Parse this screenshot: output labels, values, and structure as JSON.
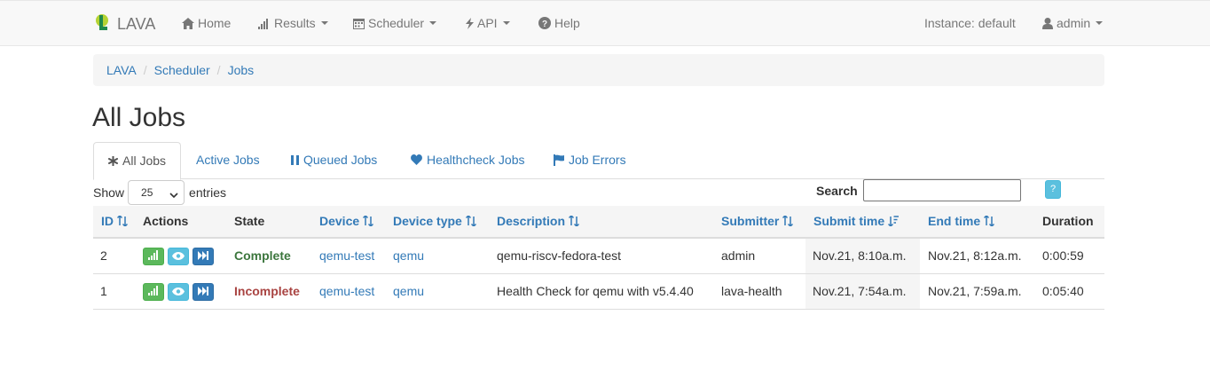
{
  "navbar": {
    "brand": "LAVA",
    "home": "Home",
    "results": "Results",
    "scheduler": "Scheduler",
    "api": "API",
    "help": "Help",
    "instance": "Instance: default",
    "user": "admin"
  },
  "breadcrumb": [
    "LAVA",
    "Scheduler",
    "Jobs"
  ],
  "page_title": "All Jobs",
  "tabs": [
    {
      "label": "All Jobs",
      "icon": "asterisk-icon",
      "active": true
    },
    {
      "label": "Active Jobs",
      "icon": "",
      "active": false
    },
    {
      "label": "Queued Jobs",
      "icon": "pause-icon",
      "active": false
    },
    {
      "label": "Healthcheck Jobs",
      "icon": "heart-icon",
      "active": false
    },
    {
      "label": "Job Errors",
      "icon": "flag-icon",
      "active": false
    }
  ],
  "controls": {
    "show_label": "Show",
    "entries_value": "25",
    "entries_label": "entries",
    "search_label": "Search",
    "search_value": "",
    "help_label": "?"
  },
  "table": {
    "headers": [
      "ID",
      "Actions",
      "State",
      "Device",
      "Device type",
      "Description",
      "Submitter",
      "Submit time",
      "End time",
      "Duration"
    ],
    "rows": [
      {
        "id": "2",
        "state": "Complete",
        "device": "qemu-test",
        "device_type": "qemu",
        "description": "qemu-riscv-fedora-test",
        "submitter": "admin",
        "submit_time": "Nov.21, 8:10a.m.",
        "end_time": "Nov.21, 8:12a.m.",
        "duration": "0:00:59"
      },
      {
        "id": "1",
        "state": "Incomplete",
        "device": "qemu-test",
        "device_type": "qemu",
        "description": "Health Check for qemu with v5.4.40",
        "submitter": "lava-health",
        "submit_time": "Nov.21, 7:54a.m.",
        "end_time": "Nov.21, 7:59a.m.",
        "duration": "0:05:40"
      }
    ]
  },
  "colors": {
    "link": "#337ab7",
    "complete": "#3c763d",
    "incomplete": "#a94442",
    "btn_green": "#5cb85c",
    "btn_info": "#5bc0de",
    "btn_primary": "#337ab7"
  }
}
